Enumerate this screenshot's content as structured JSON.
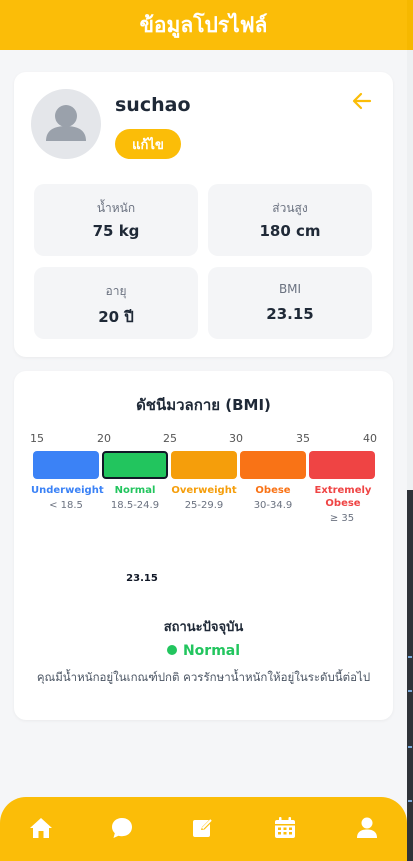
{
  "header": {
    "title": "ข้อมูลโปรไฟล์"
  },
  "profile": {
    "username": "suchao",
    "edit_label": "แก้ไข",
    "stats": {
      "weight": {
        "label": "น้ำหนัก",
        "value": "75 kg"
      },
      "height": {
        "label": "ส่วนสูง",
        "value": "180 cm"
      },
      "age": {
        "label": "อายุ",
        "value": "20 ปี"
      },
      "bmi": {
        "label": "BMI",
        "value": "23.15"
      }
    }
  },
  "bmi": {
    "title": "ดัชนีมวลกาย (BMI)",
    "scale": [
      "15",
      "20",
      "25",
      "30",
      "35",
      "40"
    ],
    "categories": [
      {
        "name": "Underweight",
        "range": "< 18.5",
        "color": "#3b82f6"
      },
      {
        "name": "Normal",
        "range": "18.5-24.9",
        "color": "#22c55e"
      },
      {
        "name": "Overweight",
        "range": "25-29.9",
        "color": "#f59e0b"
      },
      {
        "name": "Obese",
        "range": "30-34.9",
        "color": "#f97316"
      },
      {
        "name": "Extremely Obese",
        "range": "≥ 35",
        "color": "#ef4444"
      }
    ],
    "active_category": "Normal",
    "value": "23.15",
    "status_label": "สถานะปัจจุบัน",
    "status": "Normal",
    "status_desc": "คุณมีน้ำหนักอยู่ในเกณฑ์ปกติ ควรรักษาน้ำหนักให้อยู่ในระดับนี้ต่อไป"
  },
  "nav": {
    "items": [
      "home-icon",
      "chat-icon",
      "edit-icon",
      "calendar-icon",
      "user-icon"
    ]
  },
  "colors": {
    "brand": "#fbbd08",
    "status_ok": "#22c55e"
  }
}
